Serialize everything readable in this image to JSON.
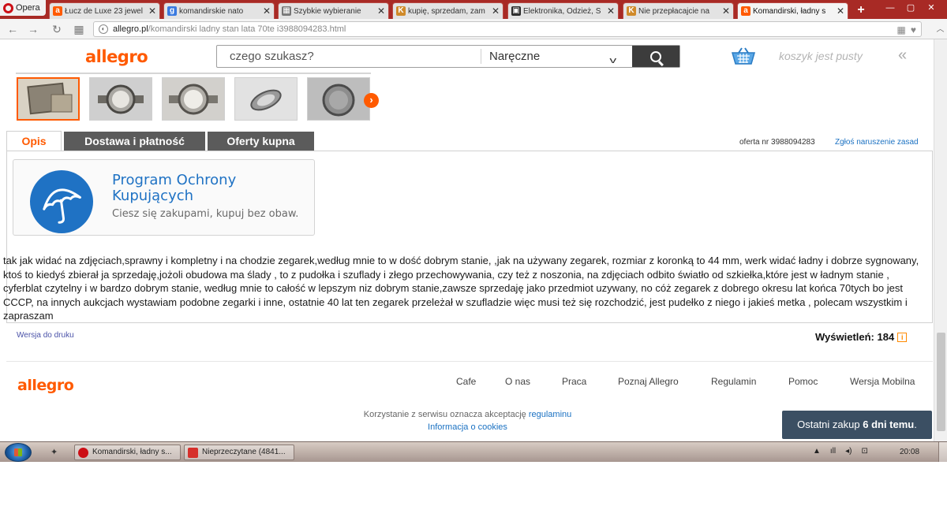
{
  "browser": {
    "menu_label": "Opera",
    "tabs": [
      {
        "title": "Łucz de Luxe 23 jewel",
        "favicon": "allegro-favicon",
        "favicon_text": "a",
        "favicon_color": "#ff5a00"
      },
      {
        "title": "komandirskie nato",
        "favicon": "google-favicon",
        "favicon_text": "g",
        "favicon_color": "#3a7ae0"
      },
      {
        "title": "Szybkie wybieranie",
        "favicon": "speed-dial-favicon",
        "favicon_text": "▦",
        "favicon_color": "#777777"
      },
      {
        "title": "kupię, sprzedam, zam",
        "favicon": "classifieds-favicon",
        "favicon_text": "K",
        "favicon_color": "#d08a2a"
      },
      {
        "title": "Elektronika, Odzież, S",
        "favicon": "shop-favicon",
        "favicon_text": "▣",
        "favicon_color": "#2a2a2a"
      },
      {
        "title": "Nie przepłacajcie na",
        "favicon": "classifieds-favicon",
        "favicon_text": "K",
        "favicon_color": "#d08a2a"
      },
      {
        "title": "Komandirski, ładny s",
        "favicon": "allegro-favicon",
        "favicon_text": "a",
        "favicon_color": "#ff5a00"
      }
    ],
    "new_tab_label": "+",
    "url_domain": "allegro.pl",
    "url_path": "/komandirski ladny stan lata 70te i3988094283.html"
  },
  "header": {
    "logo": "allegro",
    "search_placeholder": "czego szukasz?",
    "category": "Naręczne",
    "cart_label": "koszyk jest pusty",
    "collapse_label": "«"
  },
  "gallery": {
    "next_label": "›"
  },
  "tabs": {
    "description": "Opis",
    "delivery": "Dostawa i płatność",
    "offers": "Oferty kupna"
  },
  "offer": {
    "number_text": "oferta nr 3988094283",
    "report_link": "Zgłoś naruszenie zasad"
  },
  "protection": {
    "title_line1": "Program Ochrony",
    "title_line2": "Kupujących",
    "subtitle": "Ciesz się zakupami, kupuj bez obaw."
  },
  "description": {
    "text": "tak jak widać na zdjęciach,sprawny i kompletny i na chodzie zegarek,według mnie to w dość dobrym stanie, ,jak na używany zegarek, rozmiar z koronką to 44 mm, werk widać ładny i dobrze sygnowany, ktoś to kiedyś zbierał ja sprzedaję,jożoli obudowa ma ślady , to z pudołka i szuflady i złego przechowywania, czy też z noszonia, na zdjęciach odbito światło od szkiełka,które jest w ładnym stanie , cyferblat czytelny i w bardzo dobrym stanie, według mnie to całość w lepszym niz dobrym stanie,zawsze sprzedaję jako przedmiot uzywany, no cóż zegarek z dobrego okresu lat końca 70tych bo jest CCCP, na innych aukcjach wystawiam podobne zegarki i inne, ostatnie 40 lat ten zegarek przeleżał w szufladzie więc musi też się rozchodzić, jest pudełko z niego i jakieś metka , polecam wszystkim i zapraszam"
  },
  "print_link": "Wersja do druku",
  "views": {
    "label": "Wyświetleń: 184",
    "info_icon": "i"
  },
  "footer": {
    "logo": "allegro",
    "links": [
      "Cafe",
      "O nas",
      "Praca",
      "Poznaj Allegro",
      "Regulamin",
      "Pomoc",
      "Wersja Mobilna"
    ],
    "terms_prefix": "Korzystanie z serwisu oznacza akceptację",
    "terms_link": "regulaminu",
    "cookies_link": "Informacja o cookies"
  },
  "toast": {
    "prefix": "Ostatni zakup",
    "bold": "6 dni temu",
    "suffix": "."
  },
  "taskbar": {
    "items": [
      "Komandirski, ładny s...",
      "Nieprzeczytane (4841..."
    ],
    "tray_symbols": [
      "▲",
      "ıll",
      "◂)",
      "⊡"
    ],
    "clock": "20:08"
  },
  "colors": {
    "brand": "#ff5a00",
    "link": "#1a71c2",
    "protection_blue": "#1f72c4",
    "tab_inactive": "#5b5b5b",
    "toast_bg": "#3b4f63"
  }
}
